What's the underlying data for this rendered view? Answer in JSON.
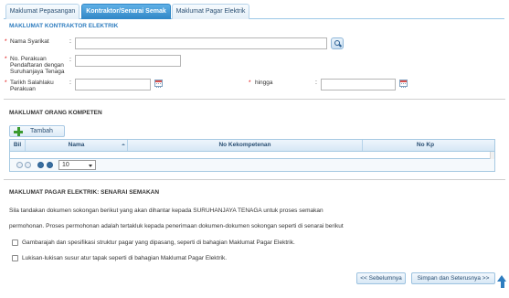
{
  "tabs": [
    {
      "label": "Maklumat Pepasangan",
      "active": false
    },
    {
      "label": "Kontraktor/Senarai Semak",
      "active": true
    },
    {
      "label": "Maklumat Pagar Elektrik",
      "active": false
    }
  ],
  "contractor": {
    "title": "MAKLUMAT KONTRAKTOR ELEKTRIK",
    "company_label": "Nama Syarikat",
    "reg_label_1": "No. Perakuan",
    "reg_label_2": "Pendaftaran dengan",
    "reg_label_3": "Suruhanjaya Tenaga",
    "valid_label_1": "Tarikh Salahlaku",
    "valid_label_2": "Perakuan",
    "until_label": "hingga",
    "required_mark": "*",
    "colon": ":"
  },
  "competent": {
    "title": "MAKLUMAT ORANG KOMPETEN",
    "add_label": "Tambah",
    "columns": [
      "Bil",
      "Nama",
      "No Kekompetenan",
      "No Kp"
    ],
    "page_size": "10"
  },
  "checklist": {
    "title": "MAKLUMAT PAGAR ELEKTRIK: SENARAI SEMAKAN",
    "intro_1": "Sila tandakan dokumen sokongan berikut yang akan dihantar kepada SURUHANJAYA TENAGA untuk proses semakan",
    "intro_2": "permohonan. Proses permohonan adalah tertakluk kepada penerimaan dokumen-dokumen sokongan seperti di senarai berikut",
    "items": [
      {
        "label": "Gambarajah dan spesifikasi struktur pagar yang dipasang, seperti di bahagian Maklumat Pagar Elektrik.",
        "checked": false
      },
      {
        "label": "Lukisan-lukisan susur atur tapak seperti di bahagian Maklumat Pagar Elektrik.",
        "checked": false
      }
    ]
  },
  "nav": {
    "prev_label": "<< Sebelumnya",
    "next_label": "Simpan dan Seterusnya >>"
  },
  "colors": {
    "accent": "#2f86c6",
    "section_title": "#2f7dbf",
    "required": "#dd0000"
  }
}
